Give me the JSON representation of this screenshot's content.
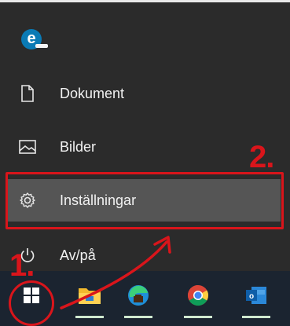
{
  "start_menu": {
    "user_avatar_letter": "e",
    "items": [
      {
        "label": "Dokument",
        "icon": "document-icon"
      },
      {
        "label": "Bilder",
        "icon": "pictures-icon"
      },
      {
        "label": "Inställningar",
        "icon": "gear-icon"
      },
      {
        "label": "Av/på",
        "icon": "power-icon"
      }
    ]
  },
  "annotations": {
    "step1": "1.",
    "step2": "2.",
    "color": "#d9151b"
  },
  "taskbar": {
    "icons": [
      "windows-start-icon",
      "file-explorer-icon",
      "edge-icon",
      "chrome-icon",
      "outlook-icon"
    ]
  }
}
